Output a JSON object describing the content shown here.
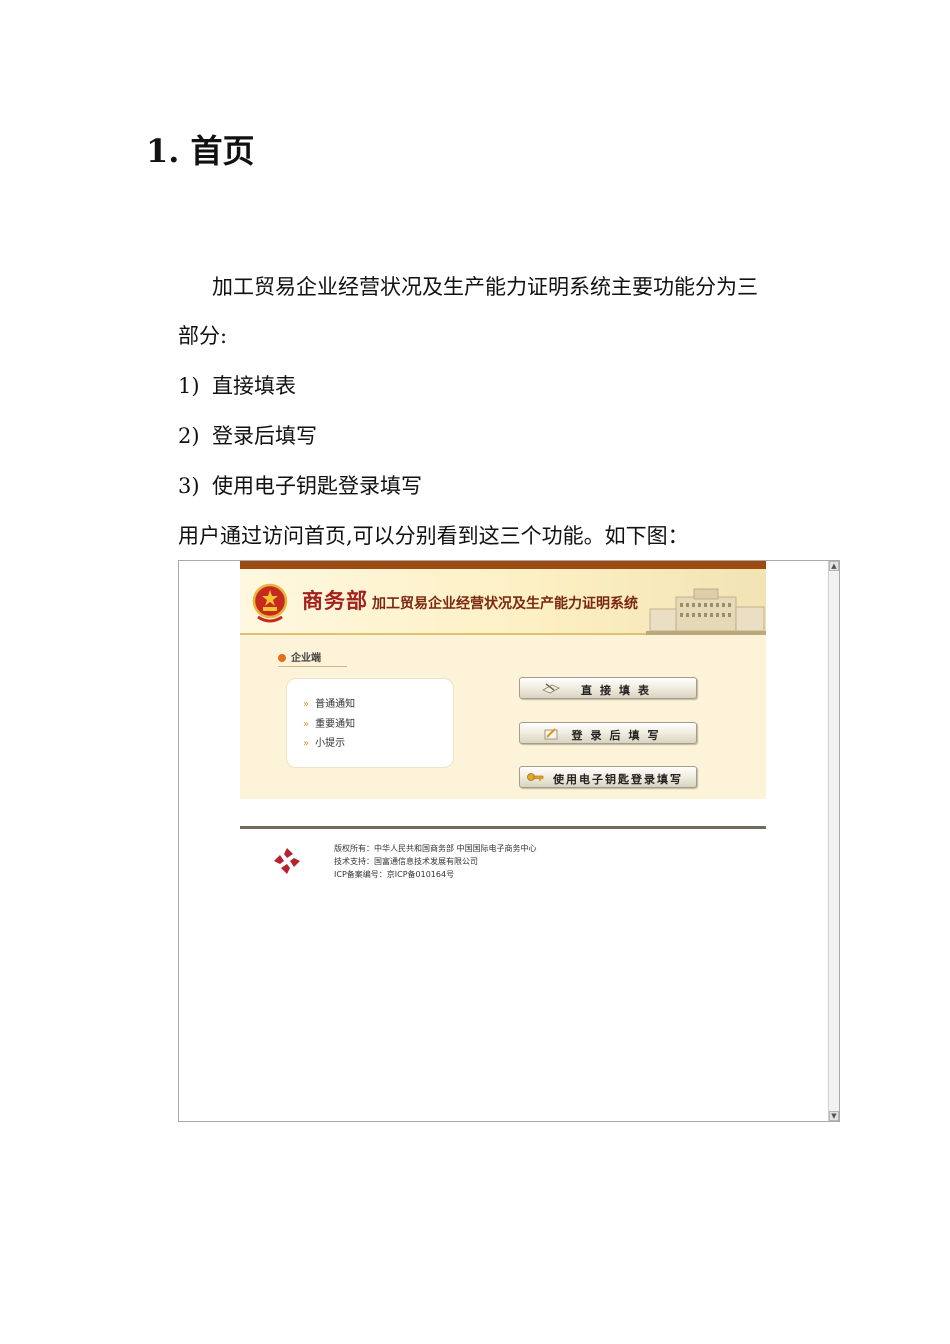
{
  "document": {
    "heading": "1. 首页",
    "intro_line1": "加工贸易企业经营状况及生产能力证明系统主要功能分为三",
    "intro_line2": "部分:",
    "list": [
      {
        "num": "1)",
        "text": "直接填表"
      },
      {
        "num": "2)",
        "text": "登录后填写"
      },
      {
        "num": "3)",
        "text": "使用电子钥匙登录填写"
      }
    ],
    "outro": "用户通过访问首页,可以分别看到这三个功能。如下图："
  },
  "screenshot": {
    "banner": {
      "ministry": "商务部",
      "system_title": "加工贸易企业经营状况及生产能力证明系统"
    },
    "section_tab": "企业端",
    "notices": [
      "普通通知",
      "重要通知",
      "小提示"
    ],
    "buttons": {
      "direct_fill": "直接填表",
      "login_fill": "登录后填写",
      "ekey_fill": "使用电子钥匙登录填写"
    },
    "footer": {
      "copyright": "版权所有：中华人民共和国商务部  中国国际电子商务中心",
      "support": "技术支持：国富通信息技术发展有限公司",
      "icp": "ICP备案编号：京ICP备010164号"
    },
    "colors": {
      "banner_top": "#9b4a12",
      "ministry_red": "#a3201c",
      "content_bg": "#fcf3d8"
    }
  }
}
